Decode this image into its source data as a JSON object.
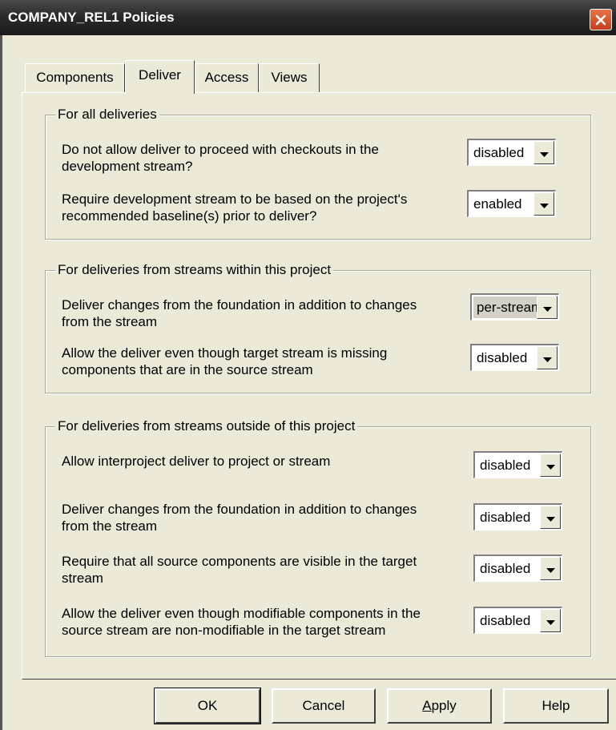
{
  "window": {
    "title": "COMPANY_REL1 Policies"
  },
  "tabs": [
    "Components",
    "Deliver",
    "Access",
    "Views"
  ],
  "groups": [
    {
      "title": "For all deliveries",
      "items": [
        {
          "label": "Do not allow deliver to proceed with checkouts in the development stream?",
          "value": "disabled"
        },
        {
          "label": "Require development stream to be based on the project's recommended baseline(s) prior to deliver?",
          "value": "enabled"
        }
      ]
    },
    {
      "title": "For deliveries from streams within this project",
      "items": [
        {
          "label": "Deliver changes from the foundation in addition to changes from the stream",
          "value": "per-stream"
        },
        {
          "label": "Allow the deliver even though target stream is missing components that are in the source stream",
          "value": "disabled"
        }
      ]
    },
    {
      "title": "For deliveries from streams outside of this project",
      "items": [
        {
          "label": "Allow interproject deliver to project or stream",
          "value": "disabled"
        },
        {
          "label": "Deliver changes from the foundation in addition to changes from the stream",
          "value": "disabled"
        },
        {
          "label": "Require that all source components are visible in the target stream",
          "value": "disabled"
        },
        {
          "label": "Allow the deliver even though modifiable components in the source stream are non-modifiable in the target stream",
          "value": "disabled"
        }
      ]
    }
  ],
  "buttons": {
    "ok": "OK",
    "cancel": "Cancel",
    "apply": "Apply",
    "help": "Help"
  },
  "icons": {
    "close": "close-icon",
    "dropdown": "chevron-down-icon"
  },
  "colors": {
    "dialog_bg": "#ece9d8",
    "title_bar": "#2b2b2b",
    "close_button": "#d9572f"
  }
}
